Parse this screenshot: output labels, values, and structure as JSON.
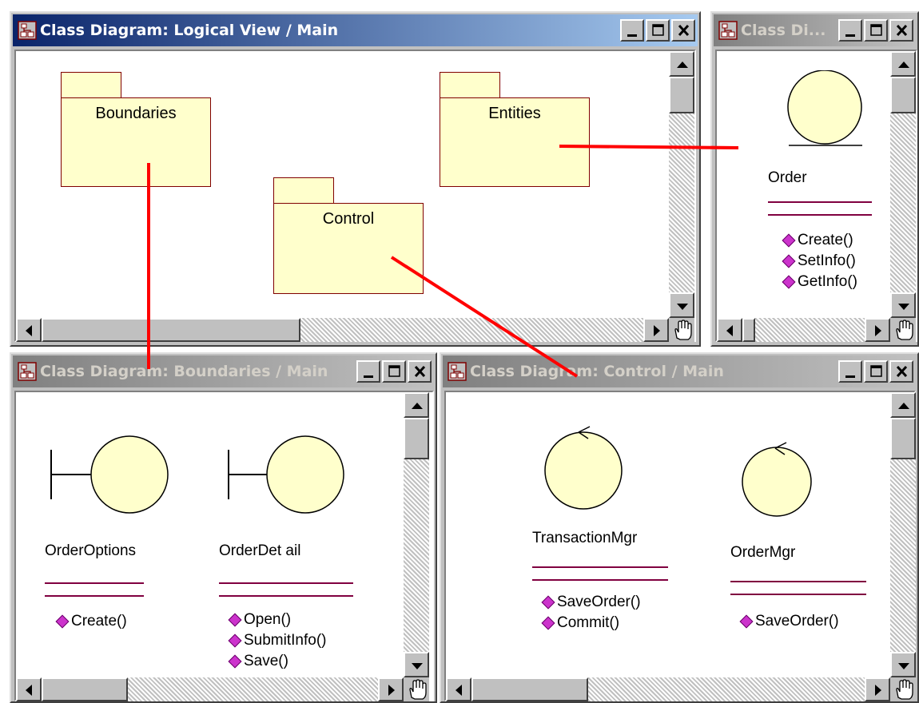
{
  "windows": {
    "main": {
      "title": "Class Diagram: Logical View / Main",
      "packages": [
        {
          "name": "Boundaries"
        },
        {
          "name": "Entities"
        },
        {
          "name": "Control"
        }
      ]
    },
    "entities": {
      "title": "Class Di...",
      "class": {
        "name": "Order",
        "operations": [
          "Create()",
          "SetInfo()",
          "GetInfo()"
        ]
      }
    },
    "boundaries": {
      "title": "Class Diagram: Boundaries / Main",
      "classes": [
        {
          "name": "OrderOptions",
          "operations": [
            "Create()"
          ]
        },
        {
          "name": "OrderDet ail",
          "operations": [
            "Open()",
            "SubmitInfo()",
            "Save()"
          ]
        }
      ]
    },
    "control": {
      "title": "Class Diagram: Control / Main",
      "classes": [
        {
          "name": "TransactionMgr",
          "operations": [
            "SaveOrder()",
            "Commit()"
          ]
        },
        {
          "name": "OrderMgr",
          "operations": [
            "SaveOrder()"
          ]
        }
      ]
    }
  },
  "colors": {
    "element_fill": "#ffffcc",
    "element_border": "#800000",
    "operation_marker": "#cc33cc",
    "connector": "#ff0000"
  }
}
